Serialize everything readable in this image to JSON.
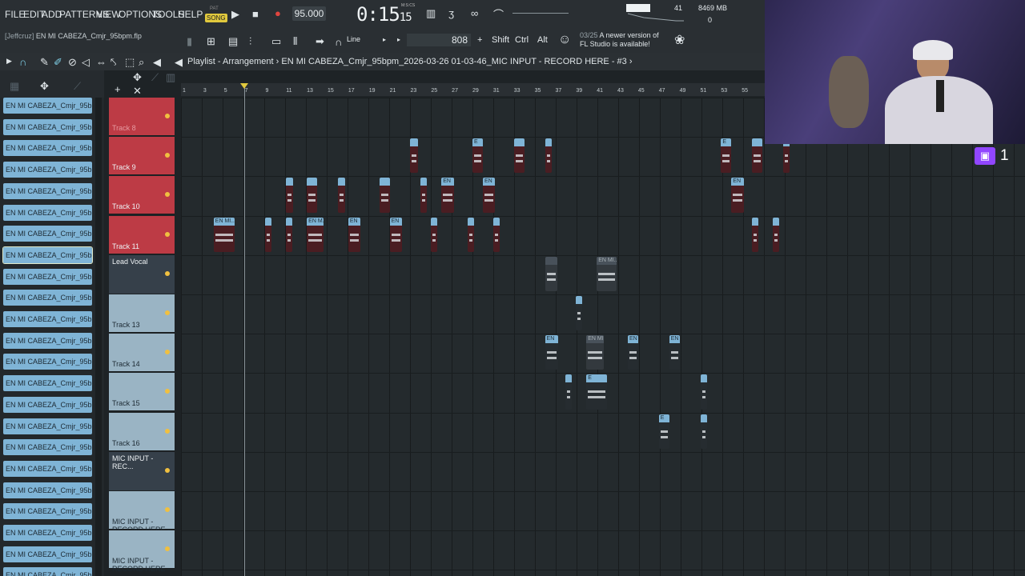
{
  "menu": [
    "FILE",
    "EDIT",
    "ADD",
    "PATTERNS",
    "VIEW",
    "OPTIONS",
    "TOOLS",
    "HELP"
  ],
  "transport": {
    "pat_label": "PAT",
    "song_label": "SONG",
    "tempo": "95.000",
    "time_main": "0:15",
    "time_sub": "15",
    "time_unit_label": "M:S:CS"
  },
  "perf": {
    "cpu": "41",
    "memory": "8469 MB",
    "poly": "0"
  },
  "project": {
    "user": "[Jeffcruz]",
    "filename": "EN MI CABEZA_Cmjr_95bpm.flp"
  },
  "toolbar2": {
    "snap_mode": "Line",
    "value": "808",
    "shift": "Shift",
    "ctrl": "Ctrl",
    "alt": "Alt"
  },
  "notice": {
    "date": "03/25",
    "line1": "A newer version of",
    "line2": "FL Studio is available!"
  },
  "playlist": {
    "title": "Playlist - Arrangement",
    "breadcrumb": "EN MI CABEZA_Cmjr_95bpm_2026-03-26 01-03-46_MIC INPUT - RECORD HERE - #3"
  },
  "patterns": [
    "EN MI CABEZA_Cmjr_95bp...",
    "EN MI CABEZA_Cmjr_95bp...",
    "EN MI CABEZA_Cmjr_95bp...",
    "EN MI CABEZA_Cmjr_95bp...",
    "EN MI CABEZA_Cmjr_95bp...",
    "EN MI CABEZA_Cmjr_95bp...",
    "EN MI CABEZA_Cmjr_95bp...",
    "EN MI CABEZA_Cmjr_95bp...",
    "EN MI CABEZA_Cmjr_95bp...",
    "EN MI CABEZA_Cmjr_95bp...",
    "EN MI CABEZA_Cmjr_95bp...",
    "EN MI CABEZA_Cmjr_95bp...",
    "EN MI CABEZA_Cmjr_95bp...",
    "EN MI CABEZA_Cmjr_95bp...",
    "EN MI CABEZA_Cmjr_95bp...",
    "EN MI CABEZA_Cmjr_95bp...",
    "EN MI CABEZA_Cmjr_95bp...",
    "EN MI CABEZA_Cmjr_95bp...",
    "EN MI CABEZA_Cmjr_95bp...",
    "EN MI CABEZA_Cmjr_95bp...",
    "EN MI CABEZA_Cmjr_95bp...",
    "EN MI CABEZA_Cmjr_95bp...",
    "EN MI CABEZA_Cmjr_95bp..."
  ],
  "tracks": [
    "Track 8",
    "Track 9",
    "Track 10",
    "Track 11",
    "Lead Vocal",
    "Track 13",
    "Track 14",
    "Track 15",
    "Track 16",
    "MIC INPUT - REC...",
    "MIC INPUT - RECORD HERE -",
    "MIC INPUT - RECORD HERE -"
  ],
  "ruler": [
    "1",
    "3",
    "5",
    "7",
    "9",
    "11",
    "13",
    "15",
    "17",
    "19",
    "21",
    "23",
    "25",
    "27",
    "29",
    "31",
    "33",
    "35",
    "37",
    "39",
    "41",
    "43",
    "45",
    "47",
    "49",
    "51",
    "53",
    "55"
  ],
  "clip_labels": {
    "en": "EN",
    "en_mi": "EN MI...",
    "en_mi_e": "EN MI...E",
    "en_m": "EN M...",
    "e": "E"
  },
  "stream": {
    "viewers": "1"
  }
}
